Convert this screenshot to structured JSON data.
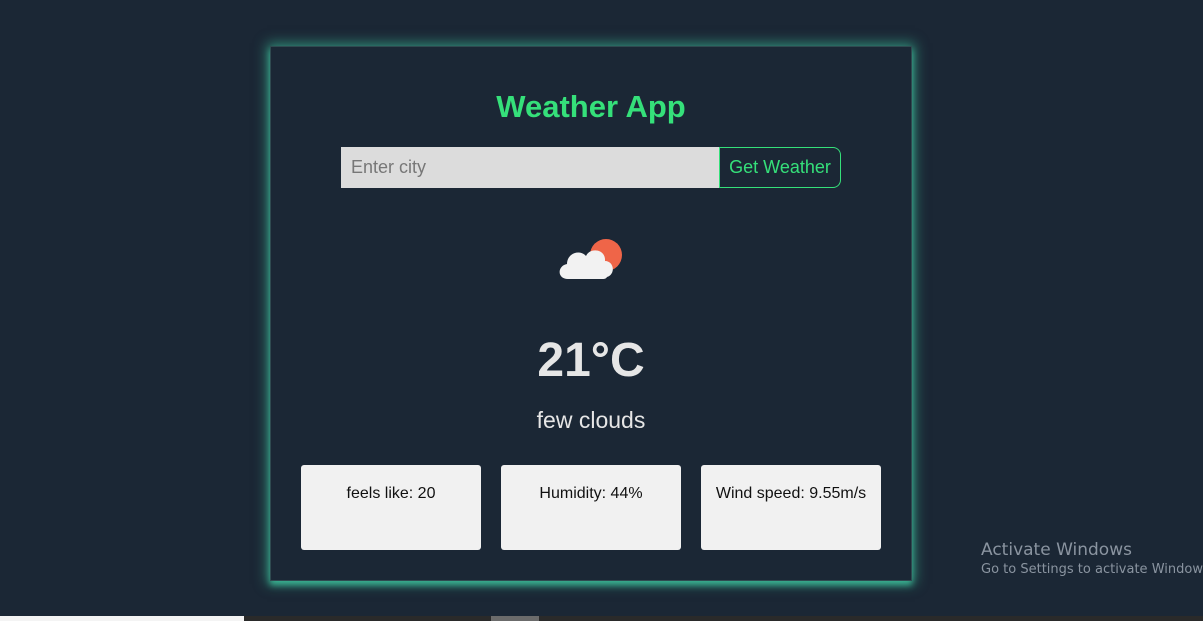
{
  "app": {
    "title": "Weather App"
  },
  "search": {
    "placeholder": "Enter city",
    "value": "",
    "button_label": "Get Weather"
  },
  "weather": {
    "icon": "few-clouds-icon",
    "temperature": "21°C",
    "description": "few clouds"
  },
  "details": [
    {
      "label": "feels like: 20"
    },
    {
      "label": "Humidity: 44%"
    },
    {
      "label": "Wind speed: 9.55m/s"
    }
  ],
  "watermark": {
    "title": "Activate Windows",
    "subtitle": "Go to Settings to activate Windows."
  },
  "colors": {
    "background": "#1b2735",
    "accent": "#35e07a",
    "glow": "#40cea4",
    "card_tile": "#f1f1f1",
    "input_bg": "#dcdcdc",
    "sun": "#ef6548",
    "cloud": "#f2f2f2"
  }
}
